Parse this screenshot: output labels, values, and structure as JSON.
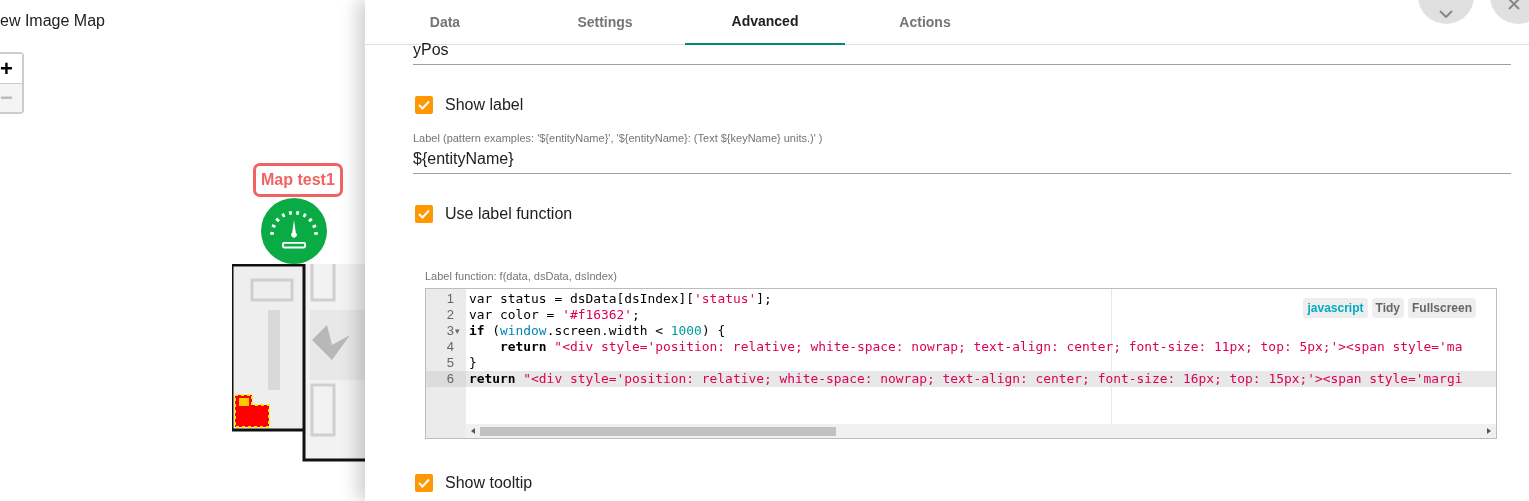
{
  "page_title": "ew Image Map",
  "zoom_controls": [
    {
      "label": "+",
      "disabled": false
    },
    {
      "label": "−",
      "disabled": true
    }
  ],
  "map": {
    "marker": {
      "label": "Map test1"
    }
  },
  "tabs": [
    {
      "label": "Data",
      "selected": false
    },
    {
      "label": "Settings",
      "selected": false
    },
    {
      "label": "Advanced",
      "selected": true
    },
    {
      "label": "Actions",
      "selected": false
    }
  ],
  "fields": [
    {
      "kind": "text",
      "value": "yPos"
    },
    {
      "kind": "checkbox",
      "label": "Show label",
      "checked": true
    },
    {
      "kind": "text",
      "label": "Label (pattern examples: '${entityName}', '${entityName}: (Text ${keyName} units.)' )",
      "value": "${entityName}"
    },
    {
      "kind": "checkbox",
      "label": "Use label function",
      "checked": true
    },
    {
      "kind": "code",
      "label": "Label function: f(data, dsData, dsIndex)",
      "editor": {
        "buttons": [
          {
            "label": "javascript",
            "kind": "mode"
          },
          {
            "label": "Tidy",
            "kind": "action"
          },
          {
            "label": "Fullscreen",
            "kind": "action"
          }
        ],
        "lines": [
          {
            "number": "1",
            "active": false,
            "tokens": [
              {
                "kind": "storage",
                "text": "var"
              },
              {
                "kind": "plain",
                "text": " status = dsData[dsIndex]["
              },
              {
                "kind": "string",
                "text": "'status'"
              },
              {
                "kind": "plain",
                "text": "];"
              }
            ]
          },
          {
            "number": "2",
            "active": false,
            "tokens": [
              {
                "kind": "storage",
                "text": "var"
              },
              {
                "kind": "plain",
                "text": " color = "
              },
              {
                "kind": "string",
                "text": "'#f16362'"
              },
              {
                "kind": "plain",
                "text": ";"
              }
            ]
          },
          {
            "number": "3",
            "active": false,
            "fold": "▾",
            "tokens": [
              {
                "kind": "keyword",
                "text": "if"
              },
              {
                "kind": "plain",
                "text": " ("
              },
              {
                "kind": "builtin",
                "text": "window"
              },
              {
                "kind": "plain",
                "text": ".screen.width < "
              },
              {
                "kind": "number",
                "text": "1000"
              },
              {
                "kind": "plain",
                "text": ") {"
              }
            ]
          },
          {
            "number": "4",
            "active": false,
            "tokens": [
              {
                "kind": "keyword",
                "text": "    return"
              },
              {
                "kind": "string",
                "text": " \"<div style='position: relative; white-space: nowrap; text-align: center; font-size: 11px; top: 5px;'><span style='ma"
              }
            ]
          },
          {
            "number": "5",
            "active": false,
            "tokens": [
              {
                "kind": "plain",
                "text": "}"
              }
            ]
          },
          {
            "number": "6",
            "active": true,
            "tokens": [
              {
                "kind": "keyword",
                "text": "return"
              },
              {
                "kind": "string",
                "text": " \"<div style='position: relative; white-space: nowrap; text-align: center; font-size: 16px; top: 15px;'><span style='margi"
              }
            ]
          }
        ]
      }
    },
    {
      "kind": "checkbox",
      "label": "Show tooltip",
      "checked": true
    }
  ]
}
